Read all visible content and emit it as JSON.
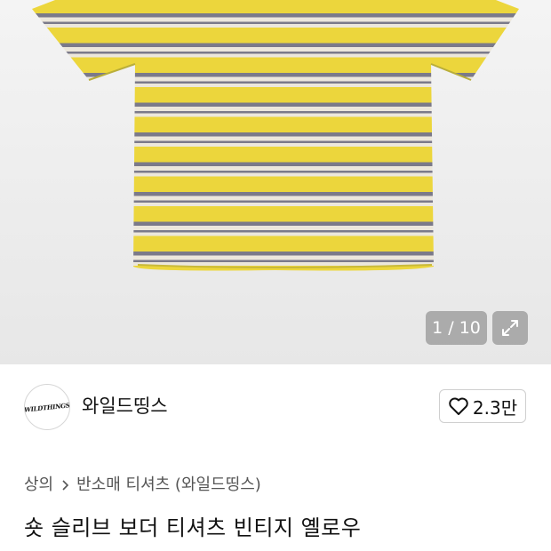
{
  "gallery": {
    "pager_text": "1 / 10",
    "background": "#ececec",
    "shirt_colors": {
      "yellow": "#ecd63c",
      "gray": "#7b7a8a",
      "cream": "#ece7dc"
    }
  },
  "brand": {
    "logo_text": "WILDTHINGS",
    "name": "와일드띵스",
    "like_count": "2.3만"
  },
  "breadcrumb": {
    "items": [
      "상의",
      "반소매 티셔츠 (와일드띵스)"
    ]
  },
  "product": {
    "title": "숏 슬리브 보더 티셔츠 빈티지 옐로우"
  }
}
